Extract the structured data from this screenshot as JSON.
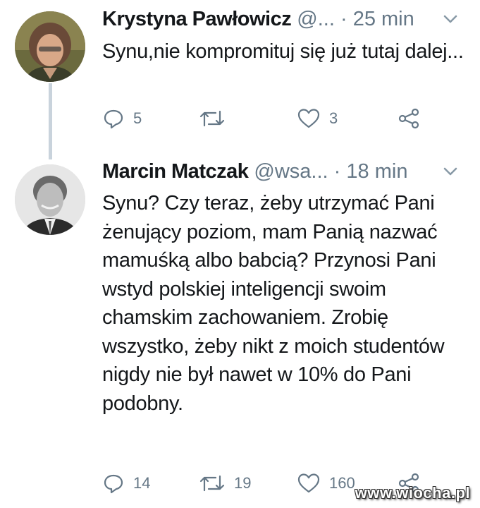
{
  "tweets": [
    {
      "name": "Krystyna Pawłowicz",
      "handle": "@...",
      "dot": "·",
      "time": "25 min",
      "text": "Synu,nie kompromituj się już tutaj dalej...",
      "replies": "5",
      "retweets": "",
      "likes": "3"
    },
    {
      "name": "Marcin Matczak",
      "handle": "@wsa...",
      "dot": "·",
      "time": "18 min",
      "text": "Synu? Czy teraz, żeby utrzymać Pani żenujący poziom, mam Panią nazwać mamuśką albo babcią? Przynosi Pani wstyd polskiej inteligencji swoim chamskim zachowaniem. Zrobię wszystko, żeby nikt z moich studentów nigdy nie był nawet w 10% do Pani podobny.",
      "replies": "14",
      "retweets": "19",
      "likes": "160"
    }
  ],
  "watermark": "www.wiocha.pl",
  "colors": {
    "text": "#14171a",
    "secondary": "#657786",
    "thread_line": "#c9d3dc"
  }
}
